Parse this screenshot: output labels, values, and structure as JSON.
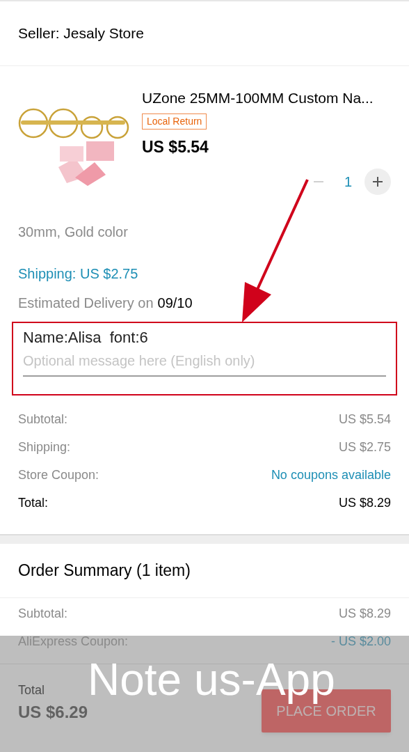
{
  "seller": {
    "label": "Seller: Jesaly Store"
  },
  "product": {
    "title": "UZone 25MM-100MM Custom Na...",
    "badge": "Local Return",
    "price": "US $5.54",
    "quantity": "1",
    "decrease_disabled": true,
    "variant": "30mm, Gold color"
  },
  "shipping": "Shipping: US $2.75",
  "delivery": {
    "label": "Estimated Delivery on",
    "date": "09/10"
  },
  "note": {
    "annotation": "Name:Alisa  font:6",
    "placeholder": "Optional message here (English only)"
  },
  "store_summary": [
    {
      "label": "Subtotal:",
      "value": "US $5.54",
      "kind": "plain"
    },
    {
      "label": "Shipping:",
      "value": "US $2.75",
      "kind": "plain"
    },
    {
      "label": "Store Coupon:",
      "value": "No coupons available",
      "kind": "link"
    },
    {
      "label": "Total:",
      "value": "US $8.29",
      "kind": "total"
    }
  ],
  "order_summary": {
    "title": "Order Summary (1 item)",
    "rows": [
      {
        "label": "Subtotal:",
        "value": "US $8.29",
        "kind": "plain"
      },
      {
        "label": "AliExpress Coupon:",
        "value": "- US $2.00",
        "kind": "link"
      }
    ]
  },
  "footer": {
    "total_label": "Total",
    "total": "US $6.29",
    "button": "PLACE ORDER"
  },
  "overlay": {
    "text": "Note us-App"
  }
}
